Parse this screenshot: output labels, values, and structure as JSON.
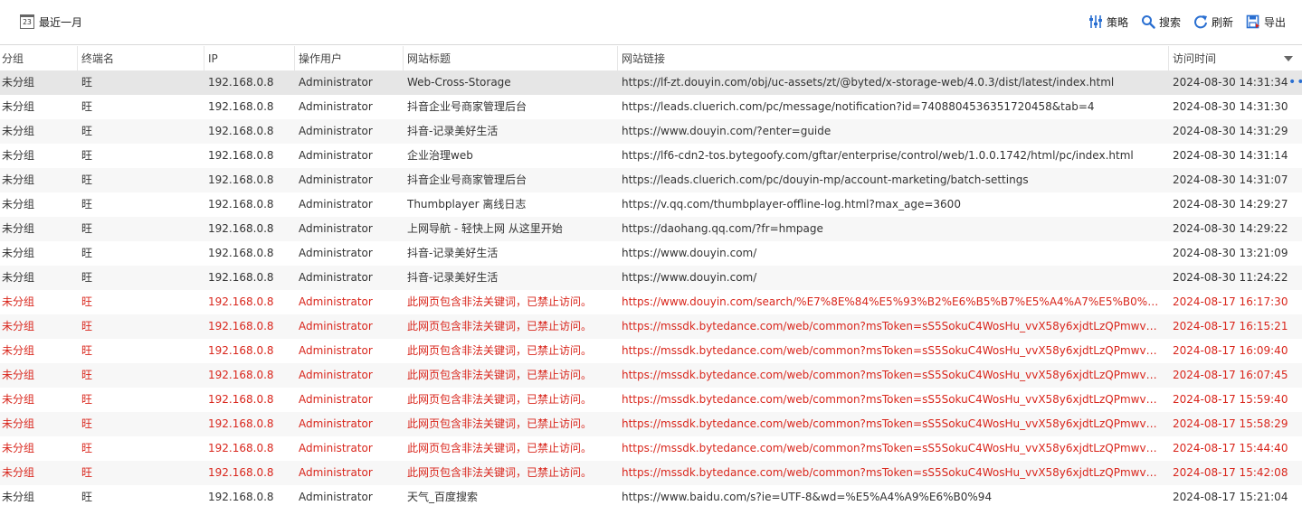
{
  "toolbar": {
    "range_icon_text": "23",
    "range_label": "最近一月",
    "actions": [
      {
        "id": "strategy",
        "label": "策略",
        "icon": "sliders-icon"
      },
      {
        "id": "search",
        "label": "搜索",
        "icon": "search-icon"
      },
      {
        "id": "refresh",
        "label": "刷新",
        "icon": "refresh-icon"
      },
      {
        "id": "export",
        "label": "导出",
        "icon": "export-icon"
      }
    ],
    "colors": {
      "icon_blue": "#2a6fd1",
      "warning_red": "#d9261c"
    }
  },
  "table": {
    "columns": [
      "分组",
      "终端名",
      "IP",
      "操作用户",
      "网站标题",
      "网站链接",
      "访问时间"
    ],
    "sorted_column": "访问时间",
    "sort_direction": "descending",
    "rows": [
      {
        "group": "未分组",
        "terminal": "旺",
        "ip": "192.168.0.8",
        "user": "Administrator",
        "title": "Web-Cross-Storage",
        "url": "https://lf-zt.douyin.com/obj/uc-assets/zt/@byted/x-storage-web/4.0.3/dist/latest/index.html",
        "time": "2024-08-30 14:31:34",
        "warn": false
      },
      {
        "group": "未分组",
        "terminal": "旺",
        "ip": "192.168.0.8",
        "user": "Administrator",
        "title": "抖音企业号商家管理后台",
        "url": "https://leads.cluerich.com/pc/message/notification?id=7408804536351720458&tab=4",
        "time": "2024-08-30 14:31:30",
        "warn": false
      },
      {
        "group": "未分组",
        "terminal": "旺",
        "ip": "192.168.0.8",
        "user": "Administrator",
        "title": "抖音-记录美好生活",
        "url": "https://www.douyin.com/?enter=guide",
        "time": "2024-08-30 14:31:29",
        "warn": false
      },
      {
        "group": "未分组",
        "terminal": "旺",
        "ip": "192.168.0.8",
        "user": "Administrator",
        "title": "企业治理web",
        "url": "https://lf6-cdn2-tos.bytegoofy.com/gftar/enterprise/control/web/1.0.0.1742/html/pc/index.html",
        "time": "2024-08-30 14:31:14",
        "warn": false
      },
      {
        "group": "未分组",
        "terminal": "旺",
        "ip": "192.168.0.8",
        "user": "Administrator",
        "title": "抖音企业号商家管理后台",
        "url": "https://leads.cluerich.com/pc/douyin-mp/account-marketing/batch-settings",
        "time": "2024-08-30 14:31:07",
        "warn": false
      },
      {
        "group": "未分组",
        "terminal": "旺",
        "ip": "192.168.0.8",
        "user": "Administrator",
        "title": "Thumbplayer 离线日志",
        "url": "https://v.qq.com/thumbplayer-offline-log.html?max_age=3600",
        "time": "2024-08-30 14:29:27",
        "warn": false
      },
      {
        "group": "未分组",
        "terminal": "旺",
        "ip": "192.168.0.8",
        "user": "Administrator",
        "title": "上网导航 - 轻快上网 从这里开始",
        "url": "https://daohang.qq.com/?fr=hmpage",
        "time": "2024-08-30 14:29:22",
        "warn": false
      },
      {
        "group": "未分组",
        "terminal": "旺",
        "ip": "192.168.0.8",
        "user": "Administrator",
        "title": "抖音-记录美好生活",
        "url": "https://www.douyin.com/",
        "time": "2024-08-30 13:21:09",
        "warn": false
      },
      {
        "group": "未分组",
        "terminal": "旺",
        "ip": "192.168.0.8",
        "user": "Administrator",
        "title": "抖音-记录美好生活",
        "url": "https://www.douyin.com/",
        "time": "2024-08-30 11:24:22",
        "warn": false
      },
      {
        "group": "未分组",
        "terminal": "旺",
        "ip": "192.168.0.8",
        "user": "Administrator",
        "title": "此网页包含非法关键词，已禁止访问。",
        "url": "https://www.douyin.com/search/%E7%8E%84%E5%93%B2%E6%B5%B7%E5%A4%A7%E5%B0%86%E…",
        "time": "2024-08-17 16:17:30",
        "warn": true
      },
      {
        "group": "未分组",
        "terminal": "旺",
        "ip": "192.168.0.8",
        "user": "Administrator",
        "title": "此网页包含非法关键词，已禁止访问。",
        "url": "https://mssdk.bytedance.com/web/common?msToken=sS5SokuC4WosHu_vvX58y6xjdtLzQPmwvNzO…",
        "time": "2024-08-17 16:15:21",
        "warn": true
      },
      {
        "group": "未分组",
        "terminal": "旺",
        "ip": "192.168.0.8",
        "user": "Administrator",
        "title": "此网页包含非法关键词，已禁止访问。",
        "url": "https://mssdk.bytedance.com/web/common?msToken=sS5SokuC4WosHu_vvX58y6xjdtLzQPmwvNzO…",
        "time": "2024-08-17 16:09:40",
        "warn": true
      },
      {
        "group": "未分组",
        "terminal": "旺",
        "ip": "192.168.0.8",
        "user": "Administrator",
        "title": "此网页包含非法关键词，已禁止访问。",
        "url": "https://mssdk.bytedance.com/web/common?msToken=sS5SokuC4WosHu_vvX58y6xjdtLzQPmwvNzO…",
        "time": "2024-08-17 16:07:45",
        "warn": true
      },
      {
        "group": "未分组",
        "terminal": "旺",
        "ip": "192.168.0.8",
        "user": "Administrator",
        "title": "此网页包含非法关键词，已禁止访问。",
        "url": "https://mssdk.bytedance.com/web/common?msToken=sS5SokuC4WosHu_vvX58y6xjdtLzQPmwvNzO…",
        "time": "2024-08-17 15:59:40",
        "warn": true
      },
      {
        "group": "未分组",
        "terminal": "旺",
        "ip": "192.168.0.8",
        "user": "Administrator",
        "title": "此网页包含非法关键词，已禁止访问。",
        "url": "https://mssdk.bytedance.com/web/common?msToken=sS5SokuC4WosHu_vvX58y6xjdtLzQPmwvNzO…",
        "time": "2024-08-17 15:58:29",
        "warn": true
      },
      {
        "group": "未分组",
        "terminal": "旺",
        "ip": "192.168.0.8",
        "user": "Administrator",
        "title": "此网页包含非法关键词，已禁止访问。",
        "url": "https://mssdk.bytedance.com/web/common?msToken=sS5SokuC4WosHu_vvX58y6xjdtLzQPmwvNzO…",
        "time": "2024-08-17 15:44:40",
        "warn": true
      },
      {
        "group": "未分组",
        "terminal": "旺",
        "ip": "192.168.0.8",
        "user": "Administrator",
        "title": "此网页包含非法关键词，已禁止访问。",
        "url": "https://mssdk.bytedance.com/web/common?msToken=sS5SokuC4WosHu_vvX58y6xjdtLzQPmwvNzO…",
        "time": "2024-08-17 15:42:08",
        "warn": true
      },
      {
        "group": "未分组",
        "terminal": "旺",
        "ip": "192.168.0.8",
        "user": "Administrator",
        "title": "天气_百度搜索",
        "url": "https://www.baidu.com/s?ie=UTF-8&wd=%E5%A4%A9%E6%B0%94",
        "time": "2024-08-17 15:21:04",
        "warn": false
      }
    ]
  }
}
